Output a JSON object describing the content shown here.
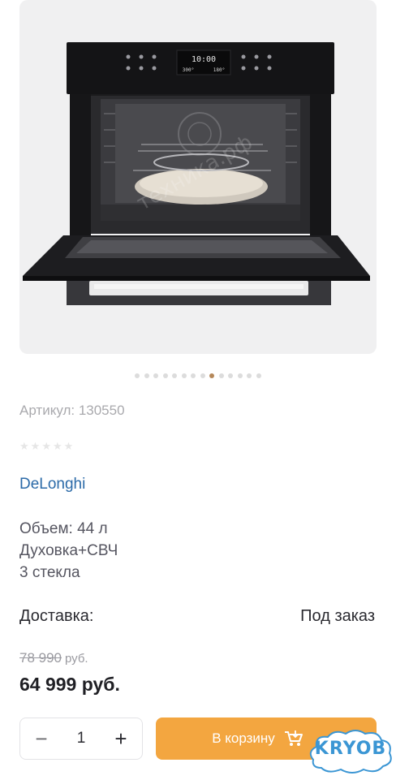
{
  "gallery": {
    "image_alt": "Встраиваемый духовой шкаф DeLonghi",
    "display": {
      "clock": "10:00",
      "temp_left": "300°",
      "temp_right": "180°"
    },
    "watermark_text": "техника.рф",
    "dots_count": 14,
    "active_dot": 8
  },
  "product": {
    "sku": "Артикул: 130550",
    "brand": "DeLonghi",
    "specs": [
      "Объем: 44 л",
      "Духовка+СВЧ",
      "3 стекла"
    ],
    "delivery_label": "Доставка:",
    "delivery_value": "Под заказ",
    "old_price": "78 990",
    "old_price_currency": "руб.",
    "price": "64 999 руб.",
    "rating_stars": 5
  },
  "purchase": {
    "quantity": "1",
    "minus": "−",
    "plus": "+",
    "cart_label": "В корзину"
  },
  "badge": {
    "text": "KRYOB"
  },
  "colors": {
    "accent": "#f3a640",
    "brand_link": "#2b6aa8",
    "active_dot": "#b5885a"
  }
}
